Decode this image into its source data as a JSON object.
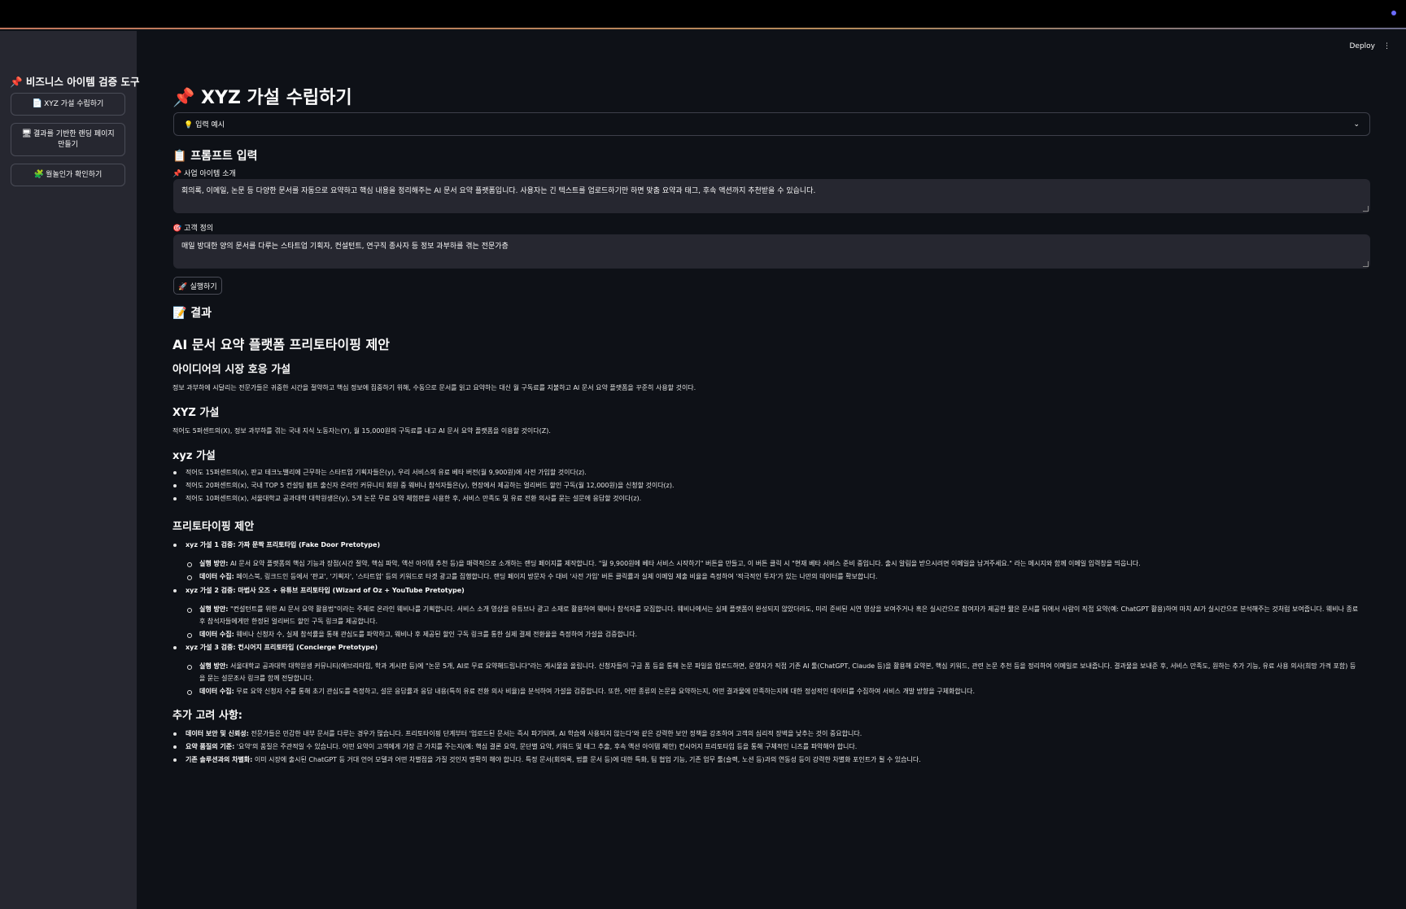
{
  "topbar": {
    "accent": "#6b6bff"
  },
  "sidebar": {
    "title": "📌 비즈니스 아이템 검증 도구",
    "items": [
      {
        "icon": "📄",
        "label": "XYZ 가설 수립하기"
      },
      {
        "icon": "🖥",
        "label": "결과를 기반한 랜딩 페이지 만들기"
      },
      {
        "icon": "🧩",
        "label": "월놀인가 확인하기"
      }
    ]
  },
  "header": {
    "deploy_label": "Deploy",
    "menu_icon": "⋮"
  },
  "main": {
    "title": "📌 XYZ 가설 수립하기",
    "expander": {
      "label": "💡 입력 예시",
      "icon": "chevron-down-icon"
    },
    "prompt_heading": "📋 프롬프트 입력",
    "idea_label": "📌 사업 아이템 소개",
    "idea_value": "회의록, 이메일, 논문 등 다양한 문서를 자동으로 요약하고 핵심 내용을 정리해주는 AI 문서 요약 플랫폼입니다. 사용자는 긴 텍스트를 업로드하기만 하면 맞춤 요약과 태그, 후속 액션까지 추천받을 수 있습니다.",
    "customer_label": "🎯 고객 정의",
    "customer_value": "매일 방대한 양의 문서를 다루는 스타트업 기획자, 컨설턴트, 연구직 종사자 등 정보 과부하를 겪는 전문가층",
    "run_label": "🚀 실행하기",
    "result_heading": "📝 결과"
  },
  "result": {
    "title": "AI 문서 요약 플랫폼 프리토타이핑 제안",
    "market_heading": "아이디어의 시장 호응 가설",
    "market_text": "정보 과부하에 시달리는 전문가들은 귀중한 시간을 절약하고 핵심 정보에 집중하기 위해, 수동으로 문서를 읽고 요약하는 대신 월 구독료를 지불하고 AI 문서 요약 플랫폼을 꾸준히 사용할 것이다.",
    "xyz_heading": "XYZ 가설",
    "xyz_text": "적어도 5퍼센트의(X), 정보 과부하를 겪는 국내 지식 노동자는(Y), 월 15,000원의 구독료를 내고 AI 문서 요약 플랫폼을 이용할 것이다(Z).",
    "xyz_small_heading": "xyz 가설",
    "xyz_small": [
      "적어도 15퍼센트의(x), 판교 테크노밸리에 근무하는 스타트업 기획자들은(y), 우리 서비스의 유료 베타 버전(월 9,900원)에 사전 가입할 것이다(z).",
      "적어도 20퍼센트의(x), 국내 TOP 5 컨설팅 펌프 출신자 온라인 커뮤니티 회원 중 웨비나 참석자들은(y), 현장에서 제공하는 얼리버드 할인 구독(월 12,000원)을 신청할 것이다(z).",
      "적어도 10퍼센트의(x), 서울대학교 공과대학 대학원생은(y), 5개 논문 무료 요약 체험판을 사용한 후, 서비스 만족도 및 유료 전환 의사를 묻는 설문에 응답할 것이다(z)."
    ],
    "proto_heading": "프리토타이핑 제안",
    "proto": [
      {
        "title": "xyz 가설 1 검증: 가짜 문짝 프리토타입 (Fake Door Pretotype)",
        "items": [
          {
            "key": "실행 방안:",
            "text": " AI 문서 요약 플랫폼의 핵심 기능과 장점(시간 절약, 핵심 파악, 액션 아이템 추천 등)을 매력적으로 소개하는 랜딩 페이지를 제작합니다. \"월 9,900원에 베타 서비스 시작하기\" 버튼을 만들고, 이 버튼 클릭 시 \"현재 베타 서비스 준비 중입니다. 출시 알림을 받으시려면 이메일을 남겨주세요.\" 라는 메시지와 함께 이메일 입력창을 띄웁니다."
          },
          {
            "key": "데이터 수집:",
            "text": " 페이스북, 링크드인 등에서 '판교', '기획자', '스타트업' 등의 키워드로 타겟 광고를 집행합니다. 랜딩 페이지 방문자 수 대비 '사전 가입' 버튼 클릭률과 실제 이메일 제출 비율을 측정하여 '적극적인 투자'가 있는 나만의 데이터를 확보합니다."
          }
        ]
      },
      {
        "title": "xyz 가설 2 검증: 마법사 오즈 + 유튜브 프리토타입 (Wizard of Oz + YouTube Pretotype)",
        "items": [
          {
            "key": "실행 방안:",
            "text": " \"컨설턴트를 위한 AI 문서 요약 활용법\"이라는 주제로 온라인 웨비나를 기획합니다. 서비스 소개 영상을 유튜브나 광고 소재로 활용하여 웨비나 참석자를 모집합니다. 웨비나에서는 실제 플랫폼이 완성되지 않았더라도, 미리 준비된 시연 영상을 보여주거나 혹은 실시간으로 참여자가 제공한 짧은 문서를 뒤에서 사람이 직접 요약(예: ChatGPT 활용)하여 마치 AI가 실시간으로 분석해주는 것처럼 보여줍니다. 웨비나 종료 후 참석자들에게만 한정된 얼리버드 할인 구독 링크를 제공합니다."
          },
          {
            "key": "데이터 수집:",
            "text": " 웨비나 신청자 수, 실제 참석률을 통해 관심도를 파악하고, 웨비나 후 제공된 할인 구독 링크를 통한 실제 결제 전환율을 측정하여 가설을 검증합니다."
          }
        ]
      },
      {
        "title": "xyz 가설 3 검증: 컨시어지 프리토타입 (Concierge Pretotype)",
        "items": [
          {
            "key": "실행 방안:",
            "text": " 서울대학교 공과대학 대학원생 커뮤니티(에브리타임, 학과 게시판 등)에 \"논문 5개, AI로 무료 요약해드립니다\"라는 게시물을 올립니다. 신청자들이 구글 폼 등을 통해 논문 파일을 업로드하면, 운영자가 직접 기존 AI 툴(ChatGPT, Claude 등)을 활용해 요약본, 핵심 키워드, 관련 논문 추천 등을 정리하여 이메일로 보내줍니다. 결과물을 보내준 후, 서비스 만족도, 원하는 추가 기능, 유료 사용 의사(희망 가격 포함) 등을 묻는 설문조사 링크를 함께 전달합니다."
          },
          {
            "key": "데이터 수집:",
            "text": " 무료 요약 신청자 수를 통해 초기 관심도를 측정하고, 설문 응답률과 응답 내용(특히 유료 전환 의사 비율)을 분석하여 가설을 검증합니다. 또한, 어떤 종류의 논문을 요약하는지, 어떤 결과물에 만족하는지에 대한 정성적인 데이터를 수집하여 서비스 개발 방향을 구체화합니다."
          }
        ]
      }
    ],
    "extra_heading": "추가 고려 사항:",
    "extra": [
      {
        "key": "데이터 보안 및 신뢰성:",
        "text": " 전문가들은 민감한 내부 문서를 다루는 경우가 많습니다. 프리토타이핑 단계부터 '업로드된 문서는 즉시 파기되며, AI 학습에 사용되지 않는다'와 같은 강력한 보안 정책을 강조하여 고객의 심리적 장벽을 낮추는 것이 중요합니다."
      },
      {
        "key": "요약 품질의 기준:",
        "text": " '요약'의 품질은 주관적일 수 있습니다. 어떤 요약이 고객에게 가장 큰 가치를 주는지(예: 핵심 결론 요약, 문단별 요약, 키워드 및 태그 추출, 후속 액션 아이템 제안) 컨시어지 프리토타입 등을 통해 구체적인 니즈를 파악해야 합니다."
      },
      {
        "key": "기존 솔루션과의 차별화:",
        "text": " 이미 시장에 출시된 ChatGPT 등 거대 언어 모델과 어떤 차별점을 가질 것인지 명확히 해야 합니다. 특정 문서(회의록, 법률 문서 등)에 대한 특화, 팀 협업 기능, 기존 업무 툴(슬랙, 노션 등)과의 연동성 등이 강력한 차별화 포인트가 될 수 있습니다."
      }
    ]
  }
}
